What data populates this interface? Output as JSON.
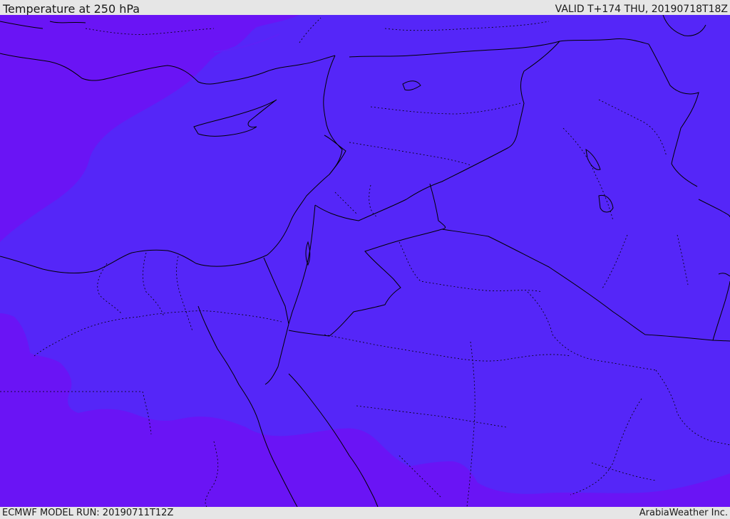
{
  "header": {
    "title": "Temperature at 250 hPa",
    "valid": "VALID T+174 THU, 20190718T18Z"
  },
  "footer": {
    "model_run": "ECMWF MODEL RUN: 20190711T12Z",
    "credit": "ArabiaWeather Inc."
  },
  "map": {
    "colors": {
      "cold_band": "#6a14f5",
      "warm_band": "#5526f8",
      "coastline": "#000000",
      "border": "#000000"
    }
  }
}
